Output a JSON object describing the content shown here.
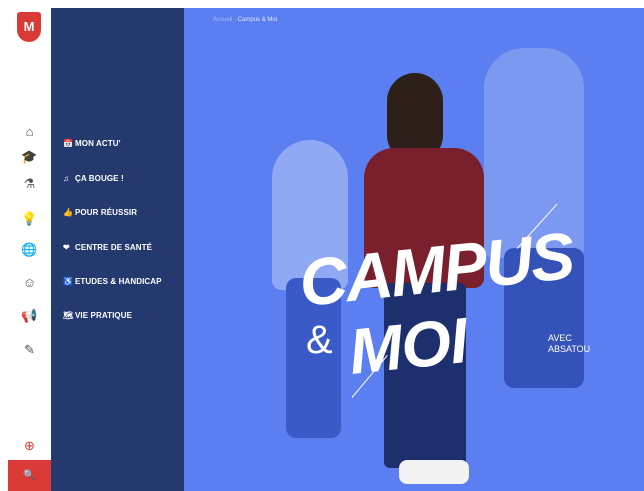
{
  "rail": {
    "logo_text": "M",
    "icons": [
      "school-icon",
      "graduation-cap-icon",
      "flask-icon",
      "lightbulb-icon",
      "globe-icon",
      "smiley-icon",
      "megaphone-icon",
      "pencil-icon"
    ],
    "plus_icon": "⊕",
    "search_icon": "🔍"
  },
  "menu": {
    "items": [
      {
        "icon": "📅",
        "label": "MON ACTU'"
      },
      {
        "icon": "♫",
        "label": "ÇA BOUGE !"
      },
      {
        "icon": "👍",
        "label": "POUR RÉUSSIR"
      },
      {
        "icon": "❤",
        "label": "CENTRE DE SANTÉ"
      },
      {
        "icon": "♿",
        "label": "ETUDES & HANDICAP"
      },
      {
        "icon": "🗺",
        "label": "VIE PRATIQUE"
      }
    ]
  },
  "breadcrumb": {
    "home": "Accueil",
    "sep": " · ",
    "current": "Campus & Moi"
  },
  "hero": {
    "title_1": "CAMPUS",
    "amp": "&",
    "title_2": "MOI",
    "subtitle_1": "AVEC",
    "subtitle_2": "ABSATOU"
  },
  "colors": {
    "accent": "#d93a35",
    "menu_bg": "#243a6e",
    "hero_bg": "#5b7ff0"
  }
}
